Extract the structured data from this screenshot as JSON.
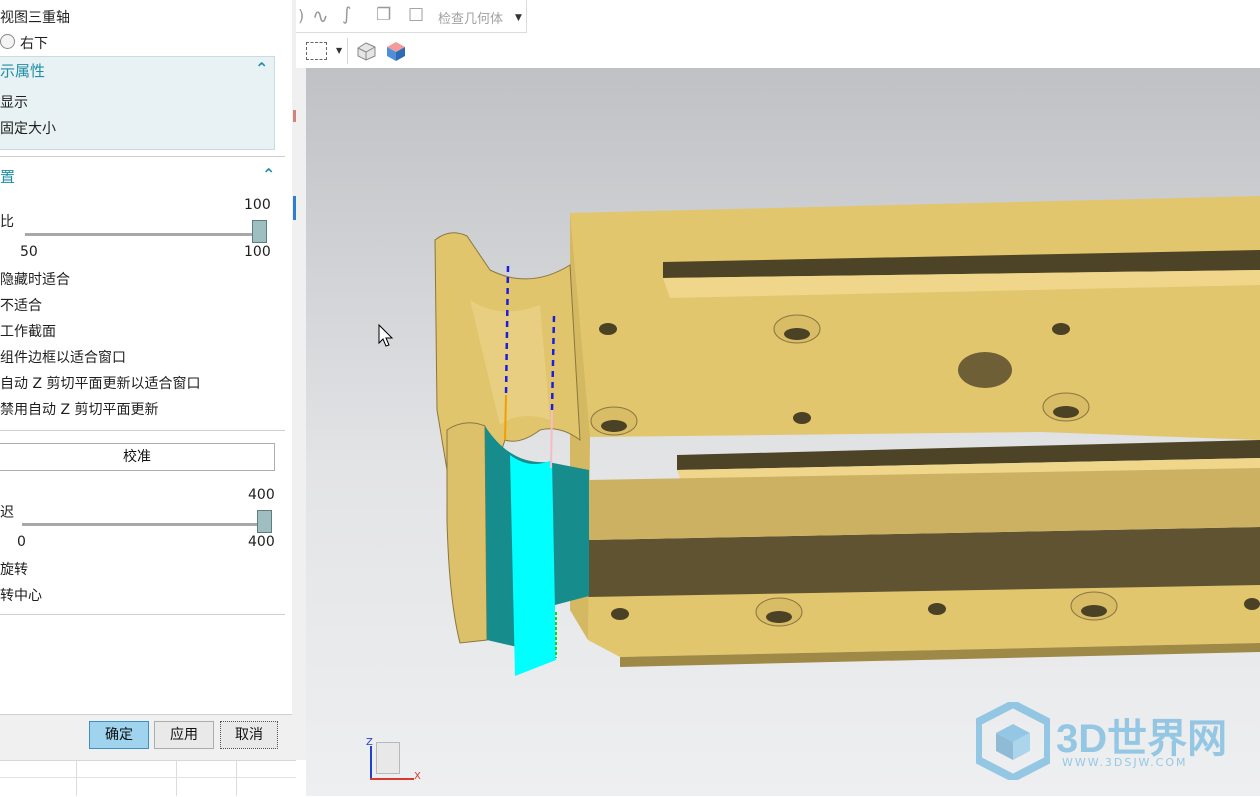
{
  "dialog": {
    "triad_label": "视图三重轴",
    "corner_option": "右下",
    "display_section_title": "示属性",
    "show_label": "显示",
    "fixed_size_label": "固定大小",
    "settings_section_title": "置",
    "ratio_label": "比",
    "ratio_value": "100",
    "ratio_min": "50",
    "ratio_max": "100",
    "ratio_fraction": 1.0,
    "opt1": "隐藏时适合",
    "opt2": "不适合",
    "opt3": "工作截面",
    "opt4": "组件边框以适合窗口",
    "opt5": "自动 Z 剪切平面更新以适合窗口",
    "opt6": "禁用自动 Z 剪切平面更新",
    "calibrate_label": "校准",
    "delay_label": "迟",
    "delay_value": "400",
    "delay_min": "0",
    "delay_max": "400",
    "delay_fraction": 1.0,
    "rotate_label": "旋转",
    "rotate_center_label": "转中心",
    "ok_label": "确定",
    "apply_label": "应用",
    "cancel_label": "取消"
  },
  "toolbar": {
    "check_geometry_label": "检查几何体",
    "icons": [
      "curve-icon",
      "spline-icon",
      "curve-analysis-icon",
      "box-icon",
      "select-box-icon",
      "dropdown-icon",
      "view-cube-icon",
      "shaded-view-icon"
    ]
  },
  "viewport": {
    "axis_z": "Z",
    "axis_x": "X",
    "watermark_main": "3D世界网",
    "watermark_sub": "WWW.3DSJW.COM",
    "colors": {
      "part_body": "#e1c56c",
      "part_shadow": "#5f5331",
      "highlight_face": "#00ffff",
      "teal_face": "#178c8d",
      "dashed_line": "#1d1de0"
    }
  }
}
